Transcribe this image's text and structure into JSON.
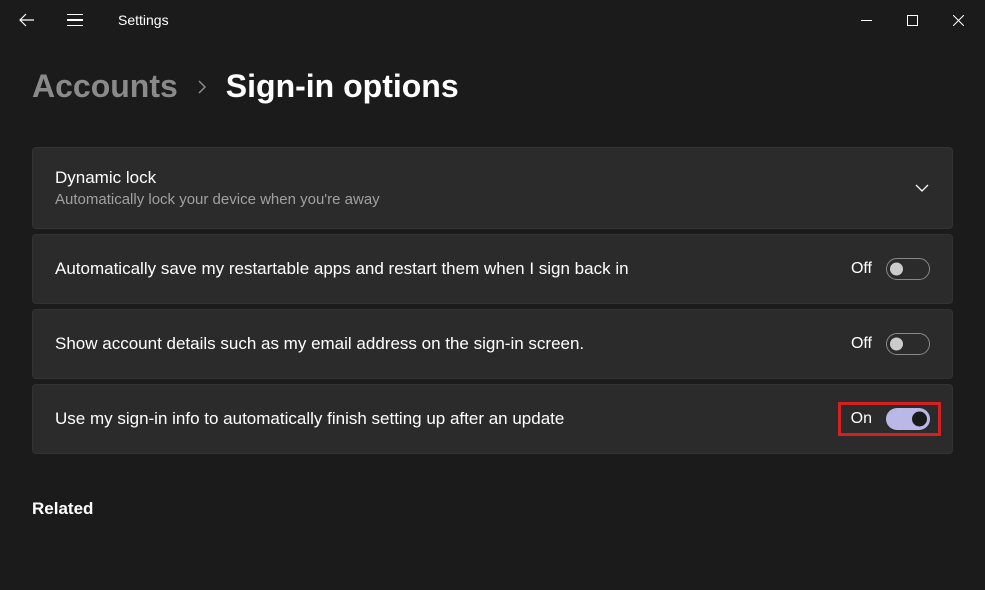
{
  "titlebar": {
    "title": "Settings"
  },
  "breadcrumb": {
    "parent": "Accounts",
    "current": "Sign-in options"
  },
  "settings": {
    "dynamicLock": {
      "title": "Dynamic lock",
      "subtitle": "Automatically lock your device when you're away"
    },
    "restartApps": {
      "label": "Automatically save my restartable apps and restart them when I sign back in",
      "state": "Off"
    },
    "accountDetails": {
      "label": "Show account details such as my email address on the sign-in screen.",
      "state": "Off"
    },
    "signInInfo": {
      "label": "Use my sign-in info to automatically finish setting up after an update",
      "state": "On"
    }
  },
  "related": {
    "title": "Related"
  }
}
